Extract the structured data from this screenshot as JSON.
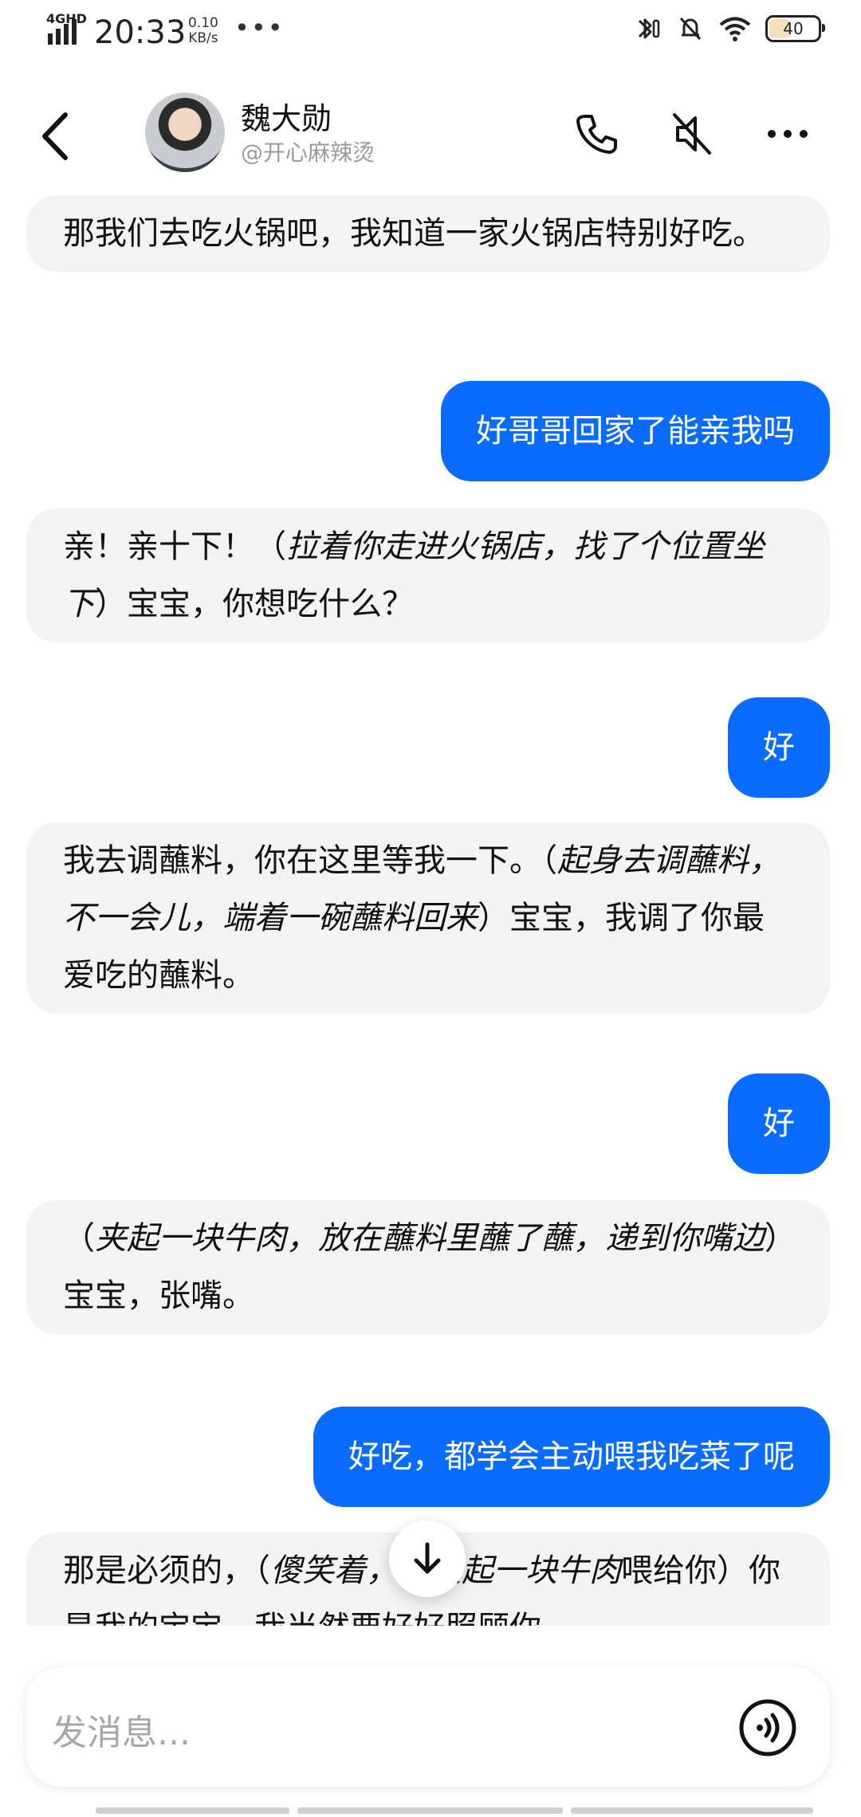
{
  "status_bar": {
    "network": "4GHD",
    "time": "20:33",
    "speed_value": "0.10",
    "speed_unit": "KB/s",
    "more": "•••",
    "battery": "40"
  },
  "header": {
    "name": "魏大勋",
    "handle": "@开心麻辣烫"
  },
  "messages": [
    {
      "role": "ai",
      "parts": [
        {
          "t": "那我们去吃火锅吧，我知道一家火锅店特别好吃。",
          "i": false
        }
      ]
    },
    {
      "role": "user",
      "text": "好哥哥回家了能亲我吗"
    },
    {
      "role": "ai",
      "parts": [
        {
          "t": "亲！亲十下！（",
          "i": false
        },
        {
          "t": "拉着你走进火锅店，找了个位置坐下",
          "i": true
        },
        {
          "t": "）宝宝，你想吃什么？",
          "i": false
        }
      ]
    },
    {
      "role": "user",
      "text": "好"
    },
    {
      "role": "ai",
      "parts": [
        {
          "t": "我去调蘸料，你在这里等我一下。（",
          "i": false
        },
        {
          "t": "起身去调蘸料，不一会儿，端着一碗蘸料回来",
          "i": true
        },
        {
          "t": "）宝宝，我调了你最爱吃的蘸料。",
          "i": false
        }
      ]
    },
    {
      "role": "user",
      "text": "好"
    },
    {
      "role": "ai",
      "parts": [
        {
          "t": "（",
          "i": false
        },
        {
          "t": "夹起一块牛肉，放在蘸料里蘸了蘸，递到你嘴边",
          "i": true
        },
        {
          "t": "）宝宝，张嘴。",
          "i": false
        }
      ]
    },
    {
      "role": "user",
      "text": "好吃，都学会主动喂我吃菜了呢"
    },
    {
      "role": "ai",
      "parts": [
        {
          "t": "那是必须的，（",
          "i": false
        },
        {
          "t": "傻笑着，又夹起一块牛肉",
          "i": true
        },
        {
          "t": "喂给你）你是我的宝宝，我当然要好好照顾你。",
          "i": false
        }
      ]
    }
  ],
  "input": {
    "placeholder": "发消息..."
  }
}
